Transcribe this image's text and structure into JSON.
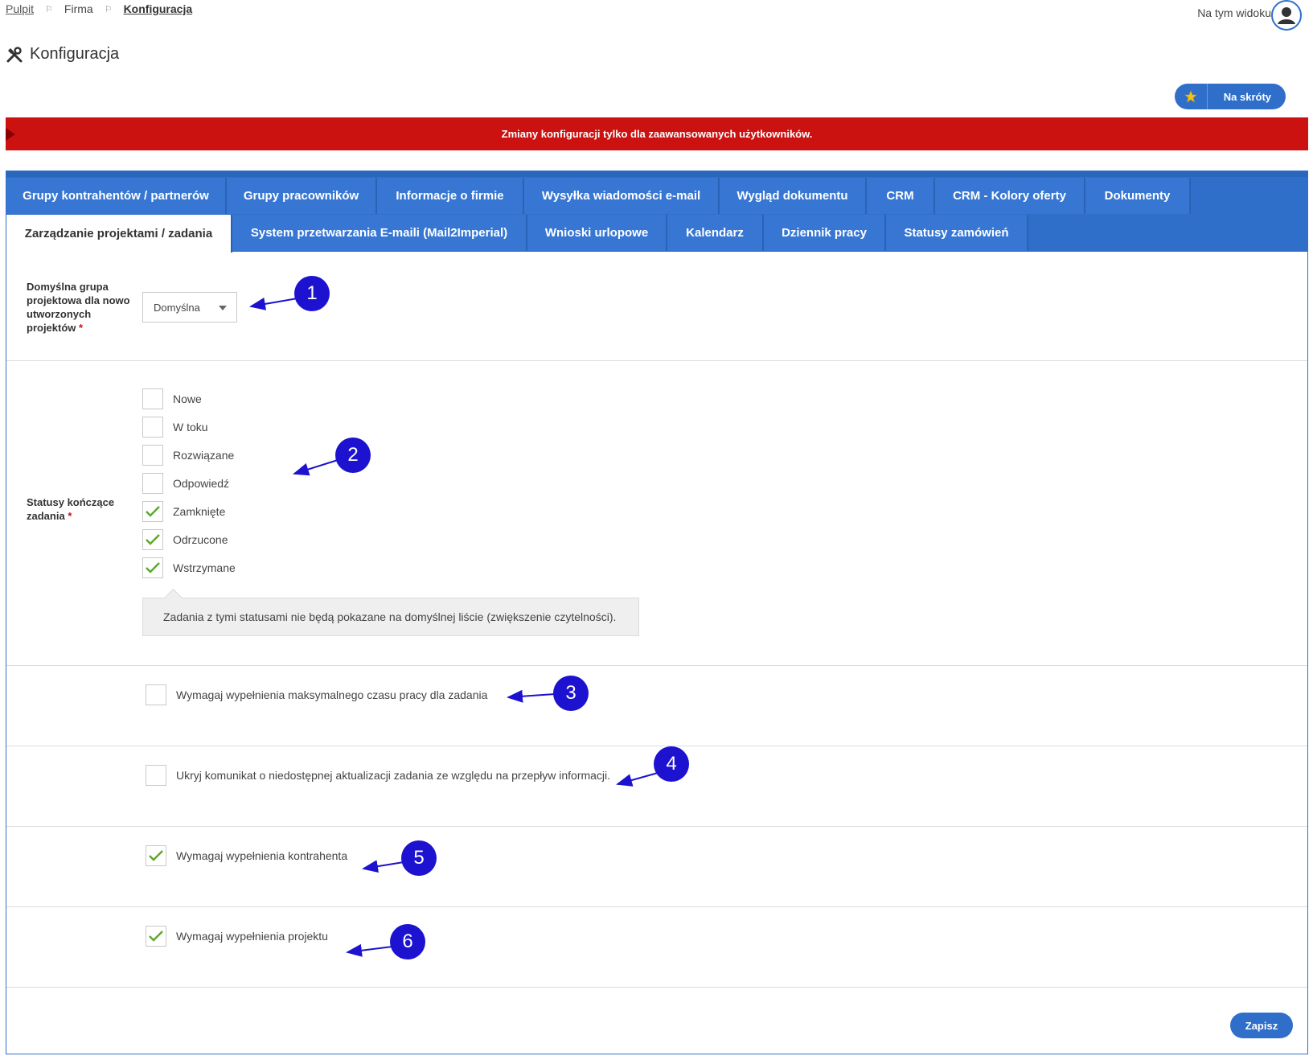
{
  "breadcrumb": {
    "home": "Pulpit",
    "company": "Firma",
    "current": "Konfiguracja"
  },
  "header": {
    "view_label": "Na tym widoku",
    "title": "Konfiguracja",
    "shortcut_label": "Na skróty"
  },
  "warning": "Zmiany konfiguracji tylko dla zaawansowanych użytkowników.",
  "tabs": {
    "row1": [
      "Grupy kontrahentów / partnerów",
      "Grupy pracowników",
      "Informacje o firmie",
      "Wysyłka wiadomości e-mail",
      "Wygląd dokumentu",
      "CRM",
      "CRM - Kolory oferty",
      "Dokumenty"
    ],
    "row2": [
      "Zarządzanie projektami / zadania",
      "System przetwarzania E-maili (Mail2Imperial)",
      "Wnioski urlopowe",
      "Kalendarz",
      "Dziennik pracy",
      "Statusy zamówień"
    ],
    "active": "Zarządzanie projektami / zadania"
  },
  "form": {
    "group_label": "Domyślna grupa projektowa dla nowo utworzonych projektów",
    "group_value": "Domyślna",
    "required_mark": "*",
    "statuses_label": "Statusy kończące zadania",
    "statuses": [
      {
        "label": "Nowe",
        "checked": false
      },
      {
        "label": "W toku",
        "checked": false
      },
      {
        "label": "Rozwiązane",
        "checked": false
      },
      {
        "label": "Odpowiedź",
        "checked": false
      },
      {
        "label": "Zamknięte",
        "checked": true
      },
      {
        "label": "Odrzucone",
        "checked": true
      },
      {
        "label": "Wstrzymane",
        "checked": true
      }
    ],
    "statuses_hint": "Zadania z tymi statusami nie będą pokazane na domyślnej liście (zwiększenie czytelności).",
    "options": [
      {
        "label": "Wymagaj wypełnienia maksymalnego czasu pracy dla zadania",
        "checked": false
      },
      {
        "label": "Ukryj komunikat o niedostępnej aktualizacji zadania ze względu na przepływ informacji.",
        "checked": false
      },
      {
        "label": "Wymagaj wypełnienia kontrahenta",
        "checked": true
      },
      {
        "label": "Wymagaj wypełnienia projektu",
        "checked": true
      }
    ],
    "save_label": "Zapisz"
  },
  "annotations": [
    "1",
    "2",
    "3",
    "4",
    "5",
    "6"
  ],
  "colors": {
    "accent": "#2f6fc9",
    "warning": "#cc1111",
    "check": "#5fa82f",
    "badge": "#1c12cf"
  }
}
